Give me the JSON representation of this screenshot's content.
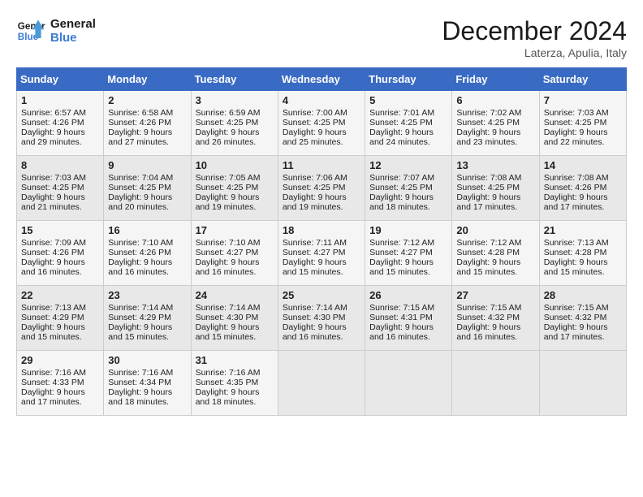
{
  "header": {
    "logo_line1": "General",
    "logo_line2": "Blue",
    "month": "December 2024",
    "location": "Laterza, Apulia, Italy"
  },
  "days_of_week": [
    "Sunday",
    "Monday",
    "Tuesday",
    "Wednesday",
    "Thursday",
    "Friday",
    "Saturday"
  ],
  "weeks": [
    [
      {
        "day": "1",
        "sunrise": "6:57 AM",
        "sunset": "4:26 PM",
        "daylight": "9 hours and 29 minutes."
      },
      {
        "day": "2",
        "sunrise": "6:58 AM",
        "sunset": "4:26 PM",
        "daylight": "9 hours and 27 minutes."
      },
      {
        "day": "3",
        "sunrise": "6:59 AM",
        "sunset": "4:25 PM",
        "daylight": "9 hours and 26 minutes."
      },
      {
        "day": "4",
        "sunrise": "7:00 AM",
        "sunset": "4:25 PM",
        "daylight": "9 hours and 25 minutes."
      },
      {
        "day": "5",
        "sunrise": "7:01 AM",
        "sunset": "4:25 PM",
        "daylight": "9 hours and 24 minutes."
      },
      {
        "day": "6",
        "sunrise": "7:02 AM",
        "sunset": "4:25 PM",
        "daylight": "9 hours and 23 minutes."
      },
      {
        "day": "7",
        "sunrise": "7:03 AM",
        "sunset": "4:25 PM",
        "daylight": "9 hours and 22 minutes."
      }
    ],
    [
      {
        "day": "8",
        "sunrise": "7:03 AM",
        "sunset": "4:25 PM",
        "daylight": "9 hours and 21 minutes."
      },
      {
        "day": "9",
        "sunrise": "7:04 AM",
        "sunset": "4:25 PM",
        "daylight": "9 hours and 20 minutes."
      },
      {
        "day": "10",
        "sunrise": "7:05 AM",
        "sunset": "4:25 PM",
        "daylight": "9 hours and 19 minutes."
      },
      {
        "day": "11",
        "sunrise": "7:06 AM",
        "sunset": "4:25 PM",
        "daylight": "9 hours and 19 minutes."
      },
      {
        "day": "12",
        "sunrise": "7:07 AM",
        "sunset": "4:25 PM",
        "daylight": "9 hours and 18 minutes."
      },
      {
        "day": "13",
        "sunrise": "7:08 AM",
        "sunset": "4:25 PM",
        "daylight": "9 hours and 17 minutes."
      },
      {
        "day": "14",
        "sunrise": "7:08 AM",
        "sunset": "4:26 PM",
        "daylight": "9 hours and 17 minutes."
      }
    ],
    [
      {
        "day": "15",
        "sunrise": "7:09 AM",
        "sunset": "4:26 PM",
        "daylight": "9 hours and 16 minutes."
      },
      {
        "day": "16",
        "sunrise": "7:10 AM",
        "sunset": "4:26 PM",
        "daylight": "9 hours and 16 minutes."
      },
      {
        "day": "17",
        "sunrise": "7:10 AM",
        "sunset": "4:27 PM",
        "daylight": "9 hours and 16 minutes."
      },
      {
        "day": "18",
        "sunrise": "7:11 AM",
        "sunset": "4:27 PM",
        "daylight": "9 hours and 15 minutes."
      },
      {
        "day": "19",
        "sunrise": "7:12 AM",
        "sunset": "4:27 PM",
        "daylight": "9 hours and 15 minutes."
      },
      {
        "day": "20",
        "sunrise": "7:12 AM",
        "sunset": "4:28 PM",
        "daylight": "9 hours and 15 minutes."
      },
      {
        "day": "21",
        "sunrise": "7:13 AM",
        "sunset": "4:28 PM",
        "daylight": "9 hours and 15 minutes."
      }
    ],
    [
      {
        "day": "22",
        "sunrise": "7:13 AM",
        "sunset": "4:29 PM",
        "daylight": "9 hours and 15 minutes."
      },
      {
        "day": "23",
        "sunrise": "7:14 AM",
        "sunset": "4:29 PM",
        "daylight": "9 hours and 15 minutes."
      },
      {
        "day": "24",
        "sunrise": "7:14 AM",
        "sunset": "4:30 PM",
        "daylight": "9 hours and 15 minutes."
      },
      {
        "day": "25",
        "sunrise": "7:14 AM",
        "sunset": "4:30 PM",
        "daylight": "9 hours and 16 minutes."
      },
      {
        "day": "26",
        "sunrise": "7:15 AM",
        "sunset": "4:31 PM",
        "daylight": "9 hours and 16 minutes."
      },
      {
        "day": "27",
        "sunrise": "7:15 AM",
        "sunset": "4:32 PM",
        "daylight": "9 hours and 16 minutes."
      },
      {
        "day": "28",
        "sunrise": "7:15 AM",
        "sunset": "4:32 PM",
        "daylight": "9 hours and 17 minutes."
      }
    ],
    [
      {
        "day": "29",
        "sunrise": "7:16 AM",
        "sunset": "4:33 PM",
        "daylight": "9 hours and 17 minutes."
      },
      {
        "day": "30",
        "sunrise": "7:16 AM",
        "sunset": "4:34 PM",
        "daylight": "9 hours and 18 minutes."
      },
      {
        "day": "31",
        "sunrise": "7:16 AM",
        "sunset": "4:35 PM",
        "daylight": "9 hours and 18 minutes."
      },
      null,
      null,
      null,
      null
    ]
  ],
  "labels": {
    "sunrise_prefix": "Sunrise: ",
    "sunset_prefix": "Sunset: ",
    "daylight_prefix": "Daylight: "
  }
}
